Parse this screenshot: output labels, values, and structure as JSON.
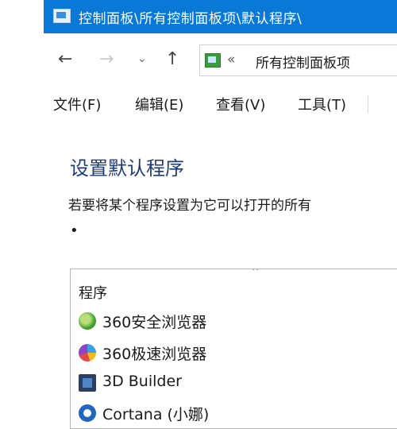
{
  "window": {
    "title": "控制面板\\所有控制面板项\\默认程序\\"
  },
  "navigation": {
    "back": "←",
    "forward": "→",
    "recent": "⌄",
    "up": "↑",
    "address_separator": "«",
    "address_path": "所有控制面板项"
  },
  "menu": {
    "file": "文件(F)",
    "edit": "编辑(E)",
    "view": "查看(V)",
    "tools": "工具(T)"
  },
  "main": {
    "title": "设置默认程序",
    "description": "若要将某个程序设置为它可以打开的所有",
    "bullet": "•"
  },
  "program_list": {
    "sort_indicator": "⌃",
    "header": "程序",
    "items": [
      {
        "name": "360安全浏览器",
        "icon": "360-safe-browser-icon"
      },
      {
        "name": "360极速浏览器",
        "icon": "360-speed-browser-icon"
      },
      {
        "name": "3D Builder",
        "icon": "3d-builder-icon"
      },
      {
        "name": "Cortana (小娜)",
        "icon": "cortana-icon"
      }
    ]
  },
  "colors": {
    "titlebar": "#0a78d7",
    "page_title": "#1e3b78"
  }
}
